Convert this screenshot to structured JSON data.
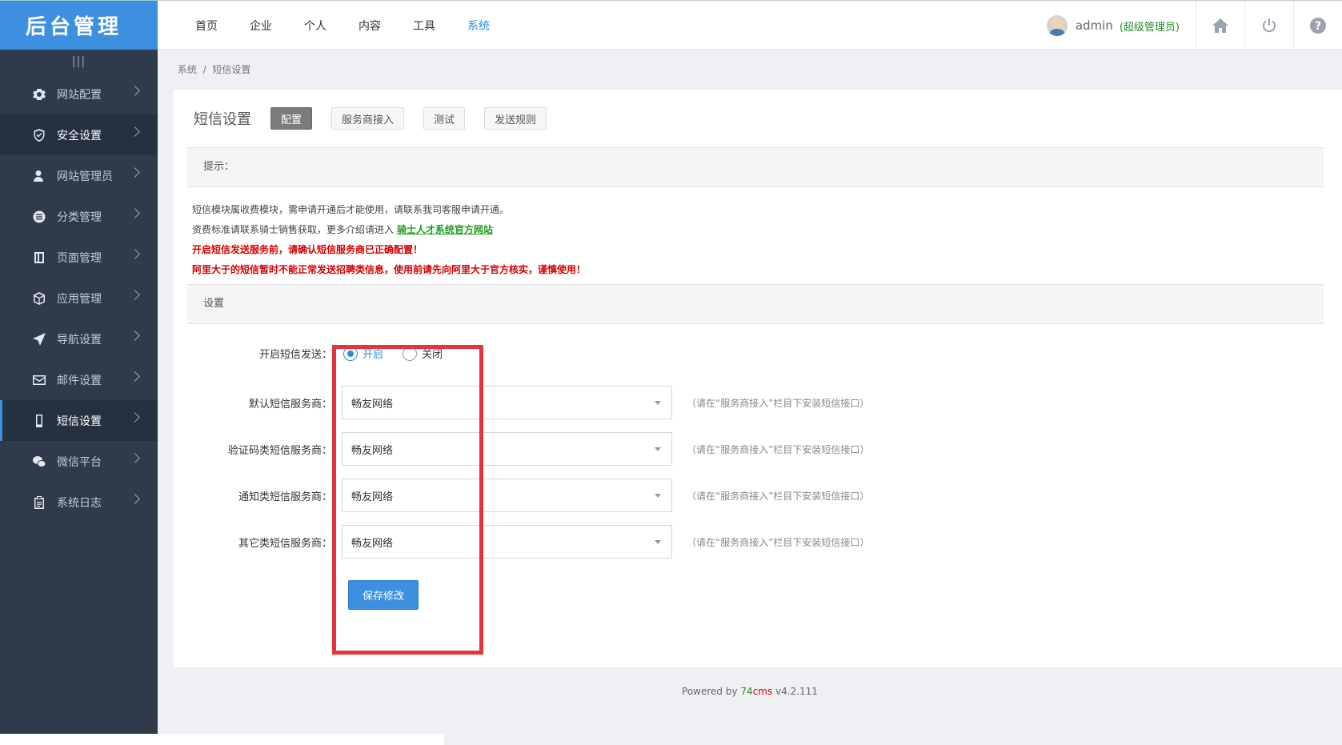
{
  "app": {
    "logo": "后台管理",
    "collapse_icon": "|||"
  },
  "sidebar": {
    "items": [
      {
        "label": "网站配置",
        "icon": "gear-icon"
      },
      {
        "label": "安全设置",
        "icon": "shield-icon"
      },
      {
        "label": "网站管理员",
        "icon": "user-icon"
      },
      {
        "label": "分类管理",
        "icon": "list-icon"
      },
      {
        "label": "页面管理",
        "icon": "page-icon"
      },
      {
        "label": "应用管理",
        "icon": "cube-icon"
      },
      {
        "label": "导航设置",
        "icon": "send-icon"
      },
      {
        "label": "邮件设置",
        "icon": "mail-icon"
      },
      {
        "label": "短信设置",
        "icon": "phone-icon"
      },
      {
        "label": "微信平台",
        "icon": "wechat-icon"
      },
      {
        "label": "系统日志",
        "icon": "clipboard-icon"
      }
    ]
  },
  "topnav": {
    "items": [
      "首页",
      "企业",
      "个人",
      "内容",
      "工具",
      "系统"
    ],
    "active": "系统"
  },
  "user": {
    "name": "admin",
    "role": "(超级管理员)"
  },
  "breadcrumb": {
    "parent": "系统",
    "separator": "/",
    "current": "短信设置"
  },
  "page": {
    "title": "短信设置",
    "tabs": [
      "配置",
      "服务商接入",
      "测试",
      "发送规则"
    ],
    "active_tab": "配置"
  },
  "tips": {
    "heading": "提示：",
    "line1": "短信模块属收费模块，需申请开通后才能使用，请联系我司客服申请开通。",
    "line2_prefix": "资费标准请联系骑士销售获取，更多介绍请进入",
    "line2_link": "骑士人才系统官方网站",
    "line3": "开启短信发送服务前，请确认短信服务商已正确配置！",
    "line4": "阿里大于的短信暂时不能正常发送招聘类信息，使用前请先向阿里大于官方核实，谨慎使用！"
  },
  "settings": {
    "heading": "设置",
    "enable_label": "开启短信发送：",
    "enable_on": "开启",
    "enable_off": "关闭",
    "selects": [
      {
        "label": "默认短信服务商：",
        "value": "畅友网络"
      },
      {
        "label": "验证码类短信服务商：",
        "value": "畅友网络"
      },
      {
        "label": "通知类短信服务商：",
        "value": "畅友网络"
      },
      {
        "label": "其它类短信服务商：",
        "value": "畅友网络"
      }
    ],
    "hint": "（请在“服务商接入”栏目下安装短信接口）",
    "save": "保存修改"
  },
  "footer": {
    "prefix": "Powered by ",
    "brand_a": "74",
    "brand_b": "cms",
    "version": " v4.2.111"
  },
  "colors": {
    "sidebar": "#2f3a4a",
    "logo_bg": "#3d8fe0",
    "accent": "#2e8bde",
    "warning": "#d40000",
    "highlight": "#e4343d"
  }
}
